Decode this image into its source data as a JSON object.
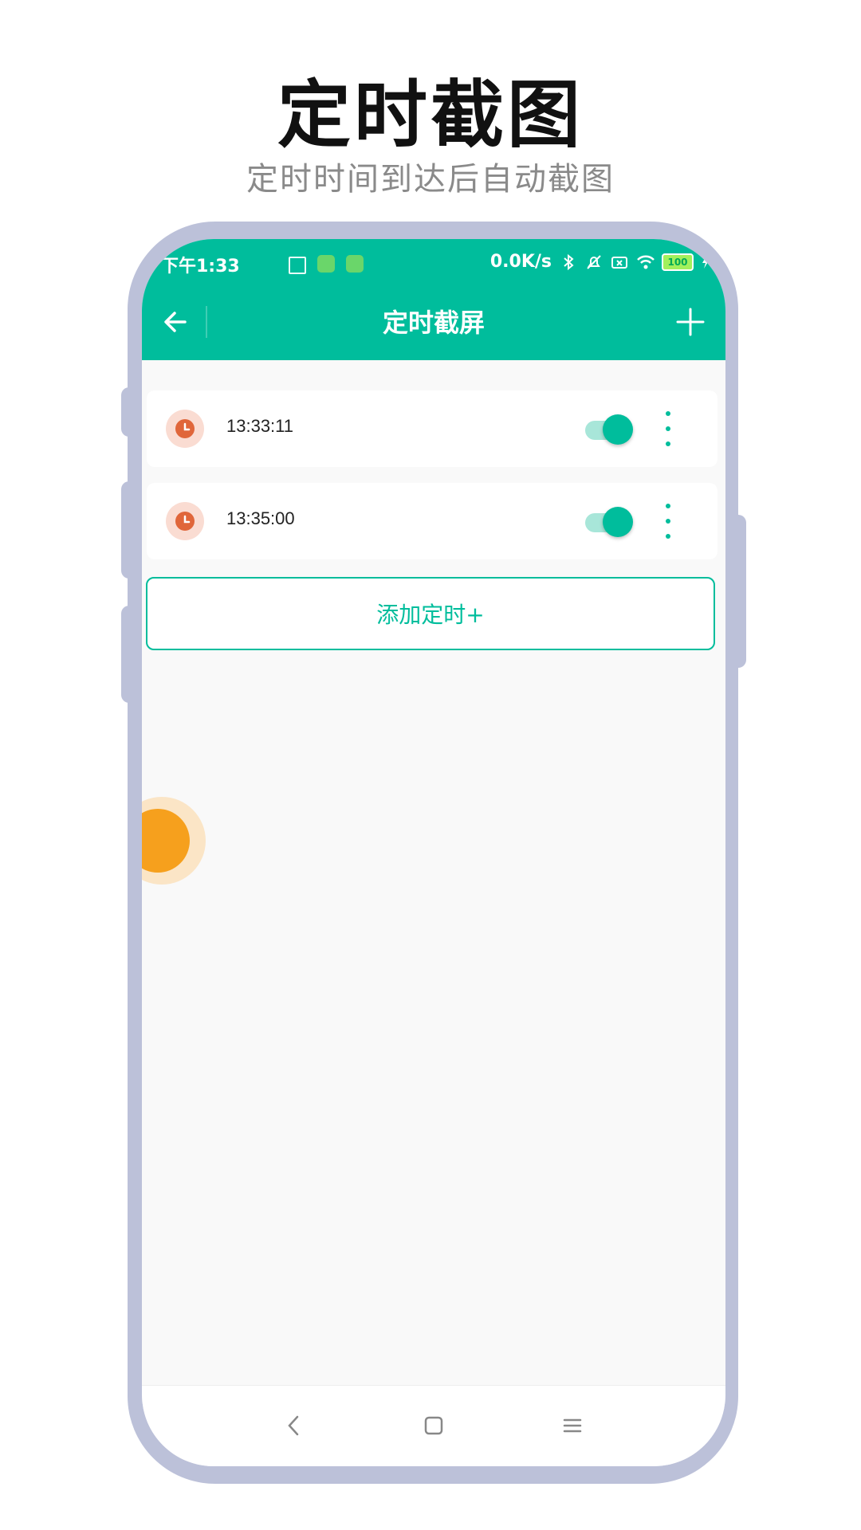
{
  "promo": {
    "title": "定时截图",
    "subtitle": "定时时间到达后自动截图"
  },
  "status_bar": {
    "time": "下午1:33",
    "net_speed": "0.0K/s",
    "battery": "100"
  },
  "app_bar": {
    "title": "定时截屏",
    "back_icon": "arrow-left-icon",
    "add_icon": "plus-icon"
  },
  "timers": [
    {
      "time": "13:33:11",
      "enabled": true
    },
    {
      "time": "13:35:00",
      "enabled": true
    }
  ],
  "add_timer_label": "添加定时+",
  "colors": {
    "primary": "#00bd9c",
    "clock": "#e0663a",
    "float_ball": "#f6a01d",
    "frame": "#bcc1d9"
  }
}
